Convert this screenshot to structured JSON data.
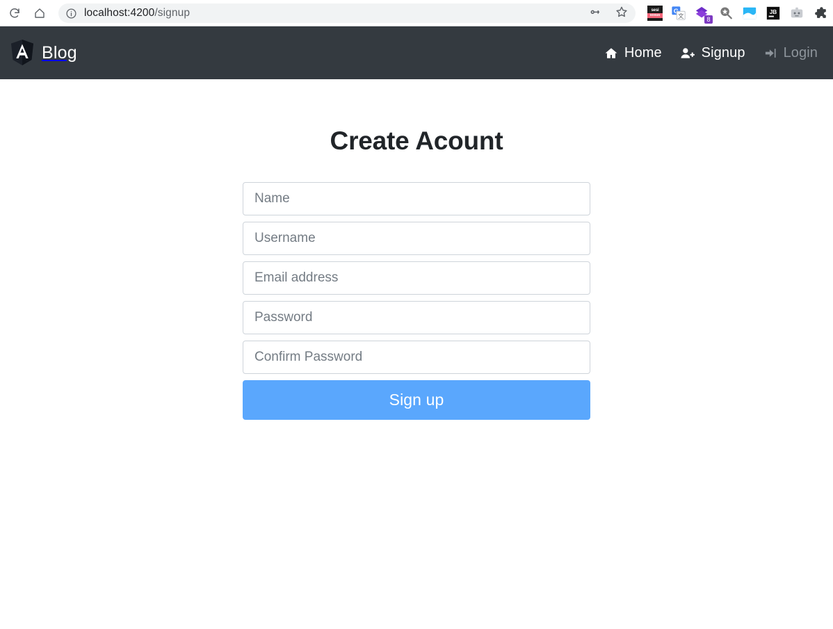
{
  "browser": {
    "reload_icon": "reload-icon",
    "home_icon": "home-icon",
    "info_icon": "site-info-icon",
    "url_host": "localhost:4200",
    "url_path": "/signup",
    "url_full": "localhost:4200/signup",
    "actions": [
      {
        "name": "password-key-icon",
        "glyph": "key-icon"
      },
      {
        "name": "bookmark-star-icon",
        "glyph": "star-icon"
      }
    ],
    "extensions": [
      {
        "name": "sesi-sosus-extension-icon",
        "top_label": "sesi",
        "bottom_label": "sosus",
        "badge": ""
      },
      {
        "name": "google-translate-extension-icon",
        "label": "G",
        "badge": ""
      },
      {
        "name": "purple-diamond-extension-icon",
        "label": "",
        "badge": "8"
      },
      {
        "name": "search-star-extension-icon",
        "label": "",
        "badge": ""
      },
      {
        "name": "blue-square-extension-icon",
        "label": "",
        "badge": ""
      },
      {
        "name": "jetbrains-extension-icon",
        "label": "JB",
        "badge": ""
      },
      {
        "name": "robot-extension-icon",
        "label": "",
        "badge": ""
      },
      {
        "name": "extensions-puzzle-icon",
        "label": "",
        "badge": ""
      }
    ]
  },
  "navbar": {
    "brand": "Blog",
    "brand_logo_icon": "angular-shield-icon",
    "background_color": "#343a40",
    "links": [
      {
        "label": "Home",
        "icon": "home-icon",
        "active": true
      },
      {
        "label": "Signup",
        "icon": "user-plus-icon",
        "active": true
      },
      {
        "label": "Login",
        "icon": "sign-in-icon",
        "active": false
      }
    ]
  },
  "main": {
    "title": "Create Acount",
    "fields": [
      {
        "name": "name",
        "placeholder": "Name",
        "value": "",
        "type": "text"
      },
      {
        "name": "username",
        "placeholder": "Username",
        "value": "",
        "type": "text"
      },
      {
        "name": "email",
        "placeholder": "Email address",
        "value": "",
        "type": "email"
      },
      {
        "name": "password",
        "placeholder": "Password",
        "value": "",
        "type": "text"
      },
      {
        "name": "confirm-password",
        "placeholder": "Confirm Password",
        "value": "",
        "type": "text"
      }
    ],
    "submit_label": "Sign up",
    "submit_color": "#5aa7fd"
  }
}
